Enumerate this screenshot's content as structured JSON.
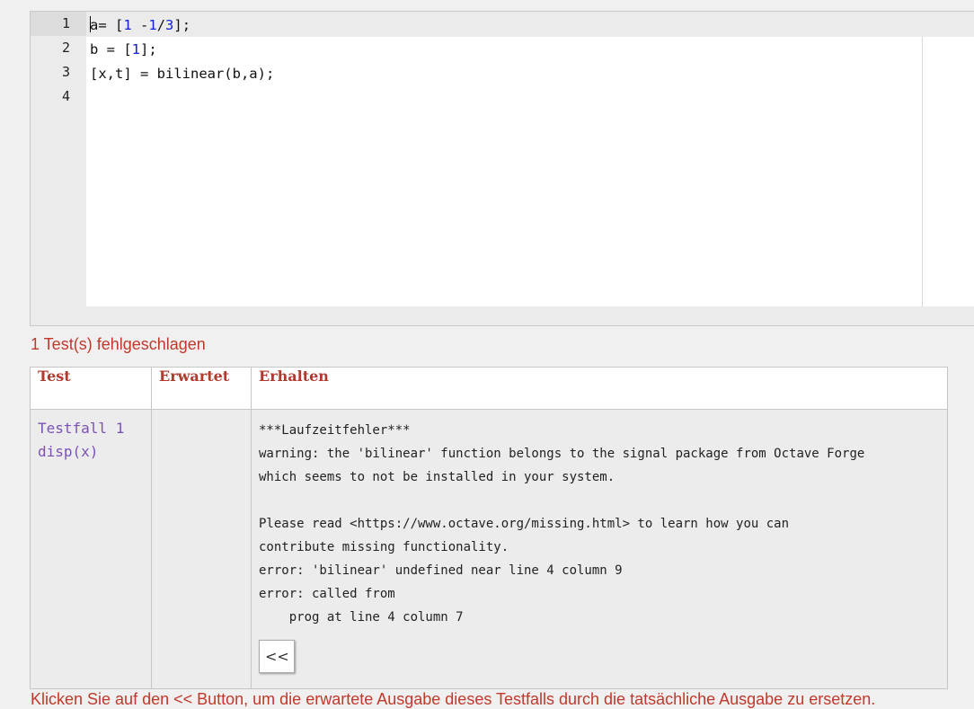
{
  "editor": {
    "line_numbers": [
      "1",
      "2",
      "3",
      "4"
    ],
    "code_lines": [
      {
        "text_a": "a= [",
        "n1": "1",
        "text_b": " -",
        "n2": "1",
        "text_c": "/",
        "n3": "3",
        "text_d": "];"
      },
      {
        "text_a": "b = [",
        "n1": "1",
        "text_b": "];"
      },
      {
        "text": "[x,t] = bilinear(b,a);"
      },
      {
        "text": ""
      }
    ]
  },
  "status": {
    "failed_text": "1 Test(s) fehlgeschlagen"
  },
  "results": {
    "headers": {
      "test": "Test",
      "expected": "Erwartet",
      "got": "Erhalten"
    },
    "rows": [
      {
        "test_name": "Testfall 1",
        "test_code": "disp(x)",
        "expected": "",
        "got": "***Laufzeitfehler***\nwarning: the 'bilinear' function belongs to the signal package from Octave Forge\nwhich seems to not be installed in your system.\n\nPlease read <https://www.octave.org/missing.html> to learn how you can\ncontribute missing functionality.\nerror: 'bilinear' undefined near line 4 column 9\nerror: called from\n    prog at line 4 column 7",
        "copy_button": "<<"
      }
    ]
  },
  "hint": {
    "text": "Klicken Sie auf den << Button, um die erwartete Ausgabe dieses Testfalls durch die tatsächliche Ausgabe zu ersetzen."
  },
  "colors": {
    "error_red": "#c0392b",
    "header_red": "#b03a2e",
    "test_purple": "#7a52b3",
    "number_blue": "#1020d8"
  }
}
